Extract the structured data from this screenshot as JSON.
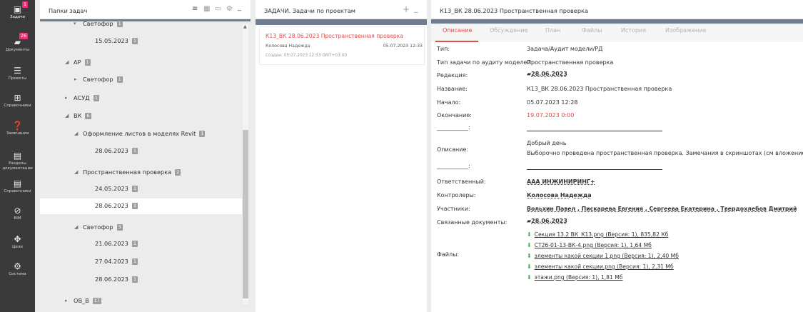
{
  "sidebar": {
    "items": [
      {
        "label": "Задачи",
        "icon": "clipboard-icon",
        "glyph": "▣",
        "badge": "1"
      },
      {
        "label": "Документы",
        "icon": "folder-icon",
        "glyph": "▰",
        "badge": "26"
      },
      {
        "label": "Проекты",
        "icon": "list-icon",
        "glyph": "☰"
      },
      {
        "label": "Справочники",
        "icon": "book-icon",
        "glyph": "⊞"
      },
      {
        "label": "Замечания",
        "icon": "help-icon",
        "glyph": "❓"
      },
      {
        "label": "Разделы документации",
        "icon": "doc-icon",
        "glyph": "▤"
      },
      {
        "label": "Справочники",
        "icon": "doc-icon",
        "glyph": "▤"
      },
      {
        "label": "BIM",
        "icon": "compass-icon",
        "glyph": "⊘"
      },
      {
        "label": "Цели",
        "icon": "target-icon",
        "glyph": "✥"
      },
      {
        "label": "Система",
        "icon": "gears-icon",
        "glyph": "⚙"
      }
    ]
  },
  "folders_panel": {
    "title": "Папки задач",
    "toolbar_icons": [
      "≡",
      "▦",
      "▭",
      "⚙",
      "_"
    ],
    "tree": [
      {
        "label": "Светофор",
        "count": "1",
        "arrow": "▾",
        "partial": true
      },
      {
        "label": "15.05.2023",
        "count": "1",
        "arrow": ""
      },
      {
        "label": "АР",
        "count": "1",
        "arrow": "◢"
      },
      {
        "label": "Светофор",
        "count": "1",
        "arrow": "▸"
      },
      {
        "label": "АСУД",
        "count": "1",
        "arrow": "▸"
      },
      {
        "label": "ВК",
        "count": "6",
        "arrow": "◢"
      },
      {
        "label": "Оформление листов в моделях Revit",
        "count": "1",
        "arrow": "◢"
      },
      {
        "label": "28.06.2023",
        "count": "1",
        "arrow": ""
      },
      {
        "label": "Пространственная проверка",
        "count": "2",
        "arrow": "◢"
      },
      {
        "label": "24.05.2023",
        "count": "1",
        "arrow": ""
      },
      {
        "label": "28.06.2023",
        "count": "1",
        "arrow": ""
      },
      {
        "label": "Светофор",
        "count": "3",
        "arrow": "◢"
      },
      {
        "label": "21.06.2023",
        "count": "1",
        "arrow": ""
      },
      {
        "label": "27.04.2023",
        "count": "1",
        "arrow": ""
      },
      {
        "label": "28.06.2023",
        "count": "1",
        "arrow": ""
      },
      {
        "label": "ОВ_В",
        "count": "17",
        "arrow": "▸"
      }
    ]
  },
  "tasks_panel": {
    "title": "ЗАДАЧИ. Задачи по проектам",
    "add": "+",
    "minimize": "_",
    "task": {
      "title": "К13_ВК 28.06.2023 Пространственная проверка",
      "author": "Колосова Надежда",
      "date": "05.07.2023 12:33",
      "created": "Создан: 05.07.2023 12:33 GMT+03:00"
    }
  },
  "detail_panel": {
    "title": "К13_ВК 28.06.2023 Пространственная проверка",
    "tabs": [
      "Описание",
      "Обсуждение",
      "План",
      "Файлы",
      "История",
      "Изображение"
    ],
    "fields": {
      "type_label": "Тип:",
      "type_value": "Задача/Аудит модели/РД",
      "audit_label": "Тип задачи по аудиту моделей:",
      "audit_value": "Пространственная проверка",
      "edition_label": "Редакция:",
      "edition_value": "28.06.2023",
      "name_label": "Название:",
      "name_value": "К13_ВК 28.06.2023 Пространственная проверка",
      "start_label": "Начало:",
      "start_value": "05.07.2023 12:28",
      "end_label": "Окончание:",
      "end_value": "19.07.2023 0:00",
      "sep1": "___________:",
      "desc_label": "Описание:",
      "desc_line1": "Добрый день",
      "desc_line2": "Выборочно проведена пространственная проверка. Замечания в скриншотах (см вложение)",
      "sep2": "___________:",
      "responsible_label": "Ответственный:",
      "responsible_value": "ААА ИНЖИНИРИНГ+",
      "controllers_label": "Контролеры:",
      "controllers_value": "Колосова Надежда",
      "participants_label": "Участники:",
      "participants_value": "Вольхин Павел , Пискарева Евгения , Сергеева Екатерина , Твердохлебов Дмитрий",
      "related_label": "Связанные документы:",
      "related_value": "28.06.2023",
      "files_label": "Файлы:"
    },
    "files": [
      "Секция 13.2 ВК_К13.png (Версия: 1), 835,82 Кб",
      "СТ26-01-13-ВК-4.png (Версия: 1), 1,64 Мб",
      "элементы какой секции 1.png (Версия: 1), 2,40 Мб",
      "элементы какой секции.png (Версия: 1), 2,31 Мб",
      "этажи.png (Версия: 1), 1,81 Мб"
    ]
  },
  "colors": {
    "sidebar": "#3a3a3a",
    "accent_red": "#e34a4a",
    "badge_pink": "#e8337b",
    "header_strip": "#6d7d8f",
    "download_green": "#3fae49"
  }
}
